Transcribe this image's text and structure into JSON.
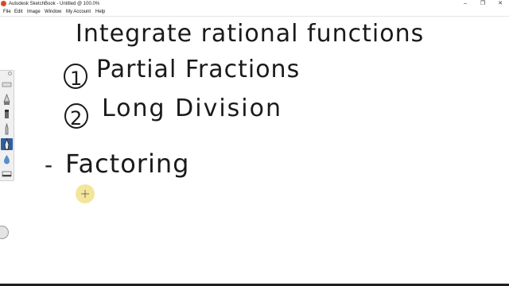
{
  "window": {
    "title": "Autodesk SketchBook - Untitled @ 100.0%",
    "controls": {
      "minimize": "–",
      "restore": "❐",
      "close": "✕"
    }
  },
  "menu": {
    "items": [
      "File",
      "Edit",
      "Image",
      "Window",
      "My Account",
      "Help"
    ]
  },
  "canvas": {
    "ink_color": "#1a1a1a",
    "handwriting": {
      "heading": "Integrate rational functions",
      "item1_number": "1",
      "item1_text": "Partial Fractions",
      "item2_number": "2",
      "item2_text": "Long Division",
      "bullet": "-",
      "item3_text": "Factoring"
    }
  },
  "toolbox": {
    "tools": [
      "ruler-icon",
      "airbrush-icon",
      "marker-icon",
      "pencil-icon",
      "ink-pen-icon",
      "paint-drop-icon",
      "eraser-icon"
    ],
    "selected_tool": "ink-pen-icon",
    "accent": "#2e5f9b"
  }
}
